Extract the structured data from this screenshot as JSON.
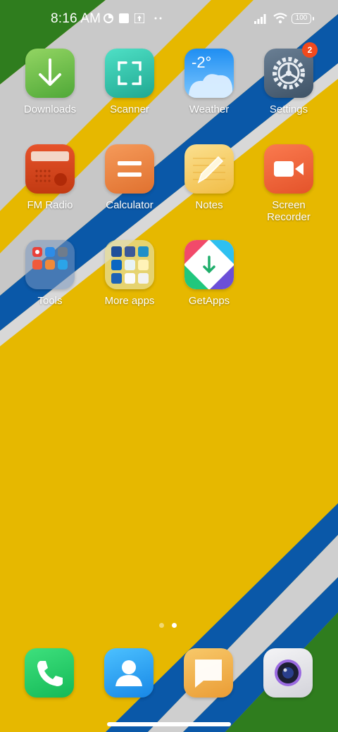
{
  "status_bar": {
    "time": "8:16 AM",
    "battery": "100",
    "icons": [
      "data-saver-icon",
      "square-notification-icon",
      "upload-notification-icon",
      "more-dots-icon",
      "signal-icon",
      "wifi-icon",
      "battery-icon"
    ]
  },
  "apps": [
    {
      "label": "Downloads",
      "icon": "download-arrow-icon"
    },
    {
      "label": "Scanner",
      "icon": "scan-frame-icon"
    },
    {
      "label": "Weather",
      "icon": "cloud-icon",
      "temp": "-2°"
    },
    {
      "label": "Settings",
      "icon": "gear-icon",
      "badge": "2"
    },
    {
      "label": "FM Radio",
      "icon": "radio-icon"
    },
    {
      "label": "Calculator",
      "icon": "equals-icon"
    },
    {
      "label": "Notes",
      "icon": "pencil-icon"
    },
    {
      "label": "Screen Recorder",
      "icon": "video-camera-icon"
    },
    {
      "label": "Tools",
      "icon": "folder-icon"
    },
    {
      "label": "More apps",
      "icon": "folder-icon"
    },
    {
      "label": "GetApps",
      "icon": "store-download-icon"
    }
  ],
  "dock": [
    {
      "name": "phone",
      "icon": "phone-handset-icon"
    },
    {
      "name": "contacts",
      "icon": "person-icon"
    },
    {
      "name": "messages",
      "icon": "message-bubble-icon"
    },
    {
      "name": "camera",
      "icon": "camera-lens-icon"
    }
  ],
  "pager": {
    "pages": 2,
    "current": 2
  },
  "colors": {
    "wallpaper_yellow": "#e6b800",
    "wallpaper_blue": "#0a58a8",
    "wallpaper_green": "#2f7d1e",
    "badge": "#f24a1d"
  }
}
